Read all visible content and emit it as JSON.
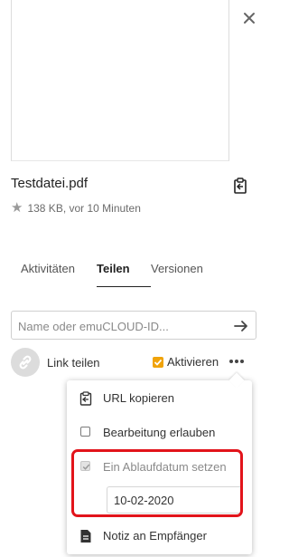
{
  "file": {
    "name": "Testdatei.pdf",
    "meta": "138 KB, vor 10 Minuten"
  },
  "tabs": [
    {
      "label": "Aktivitäten",
      "active": false
    },
    {
      "label": "Teilen",
      "active": true
    },
    {
      "label": "Versionen",
      "active": false
    }
  ],
  "share_input": {
    "value": "",
    "placeholder": "Name oder emuCLOUD-ID..."
  },
  "link_share": {
    "label": "Link teilen",
    "activate_label": "Aktivieren",
    "activate_checked": true
  },
  "menu": {
    "items": [
      {
        "label": "URL kopieren",
        "icon": "clipboard-icon"
      },
      {
        "label": "Bearbeitung erlauben",
        "checked": false
      },
      {
        "label": "Ein Ablaufdatum setzen",
        "checked": true,
        "disabled": true
      },
      {
        "label": "Notiz an Empfänger",
        "icon": "note-icon"
      }
    ],
    "expiry_date": "10-02-2020"
  },
  "colors": {
    "accent": "#f0a30a",
    "highlight": "#e2141b",
    "muted": "#8a8a8a"
  }
}
